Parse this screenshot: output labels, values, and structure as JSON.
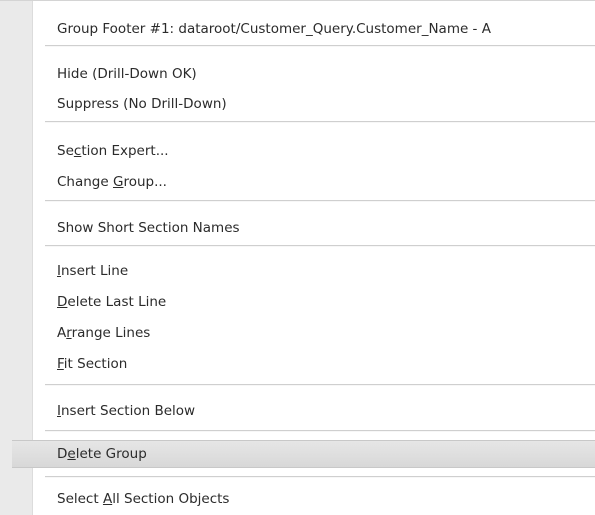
{
  "menu": {
    "items": [
      {
        "label": "Group Footer #1: dataroot/Customer_Query.Customer_Name - A"
      },
      {
        "label": "Hide (Drill-Down OK)"
      },
      {
        "label": "Suppress (No Drill-Down)"
      },
      {
        "pre": "Se",
        "key": "c",
        "post": "tion Expert..."
      },
      {
        "pre": "Change ",
        "key": "G",
        "post": "roup..."
      },
      {
        "label": "Show Short Section Names"
      },
      {
        "pre": "",
        "key": "I",
        "post": "nsert Line"
      },
      {
        "pre": "",
        "key": "D",
        "post": "elete Last Line"
      },
      {
        "pre": "A",
        "key": "r",
        "post": "range Lines"
      },
      {
        "pre": "",
        "key": "F",
        "post": "it Section"
      },
      {
        "pre": "",
        "key": "I",
        "post": "nsert Section Below"
      },
      {
        "pre": "D",
        "key": "e",
        "post": "lete Group"
      },
      {
        "pre": "Select ",
        "key": "A",
        "post": "ll Section Objects"
      }
    ]
  },
  "colors": {
    "gutter": "#eaeaea",
    "highlight": "#dcdcdc",
    "text": "#2b2b2b",
    "separator": "#cfcfcf"
  }
}
